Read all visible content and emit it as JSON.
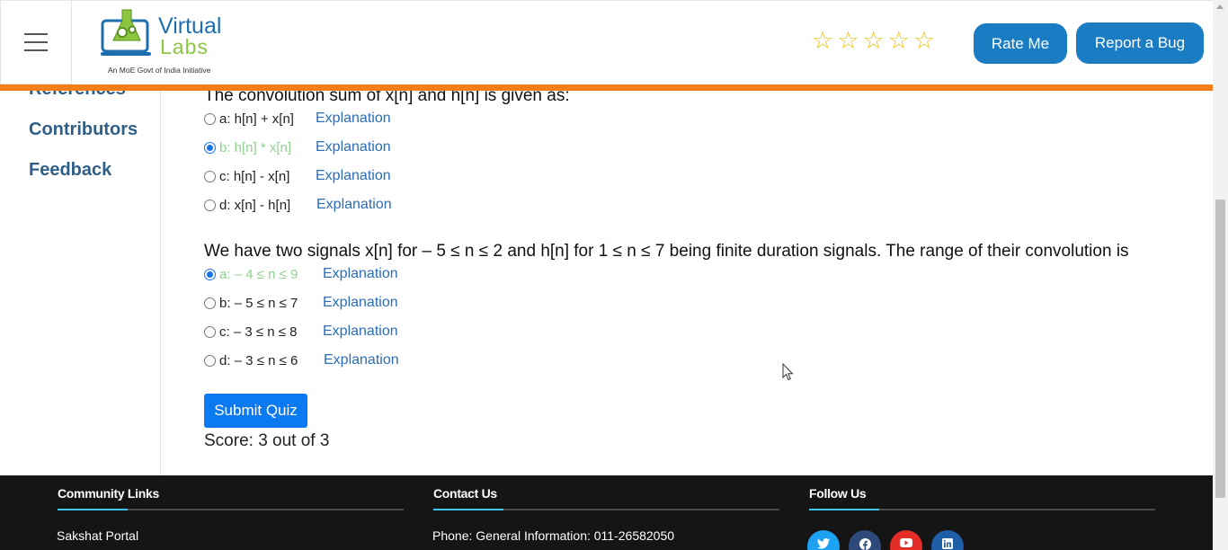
{
  "header": {
    "logo_title": "Virtual",
    "logo_subtitle": "Labs",
    "logo_tagline": "An MoE Govt of India Initiative",
    "rating_stars": [
      "☆",
      "☆",
      "☆",
      "☆",
      "☆"
    ],
    "rate_button": "Rate Me",
    "bug_button": "Report a Bug"
  },
  "sidebar": {
    "items": [
      {
        "label": "References"
      },
      {
        "label": "Contributors"
      },
      {
        "label": "Feedback"
      }
    ]
  },
  "quiz": {
    "questions": [
      {
        "text": "The convolution sum of x[n] and h[n] is given as:",
        "options": [
          {
            "text": "a: h[n] + x[n]",
            "explanation": "Explanation",
            "selected": false,
            "correct": false
          },
          {
            "text": "b: h[n] * x[n]",
            "explanation": "Explanation",
            "selected": true,
            "correct": true
          },
          {
            "text": "c: h[n] - x[n]",
            "explanation": "Explanation",
            "selected": false,
            "correct": false
          },
          {
            "text": "d: x[n] - h[n]",
            "explanation": "Explanation",
            "selected": false,
            "correct": false
          }
        ]
      },
      {
        "text": "We have two signals x[n] for – 5 ≤ n ≤ 2 and h[n] for 1 ≤ n ≤ 7 being finite duration signals. The range of their convolution is",
        "options": [
          {
            "text": "a: – 4 ≤ n ≤ 9",
            "explanation": "Explanation",
            "selected": true,
            "correct": true
          },
          {
            "text": "b: – 5 ≤ n ≤ 7",
            "explanation": "Explanation",
            "selected": false,
            "correct": false
          },
          {
            "text": "c: – 3 ≤ n ≤ 8",
            "explanation": "Explanation",
            "selected": false,
            "correct": false
          },
          {
            "text": "d: – 3 ≤ n ≤ 6",
            "explanation": "Explanation",
            "selected": false,
            "correct": false
          }
        ]
      }
    ],
    "submit_label": "Submit Quiz",
    "score_text": "Score: 3 out of 3"
  },
  "footer": {
    "community": {
      "heading": "Community Links",
      "link1": "Sakshat Portal"
    },
    "contact": {
      "heading": "Contact Us",
      "phone": "Phone: General Information: 011-26582050"
    },
    "follow": {
      "heading": "Follow Us",
      "icons": [
        "twitter-icon",
        "facebook-icon",
        "youtube-icon",
        "linkedin-icon"
      ]
    }
  },
  "colors": {
    "accent_orange": "#f47e17",
    "button_blue": "#1a7dc4",
    "submit_blue": "#0b79f0",
    "correct_green": "#8fd28f",
    "link_blue": "#2a6db8",
    "footer_bg": "#151515"
  }
}
